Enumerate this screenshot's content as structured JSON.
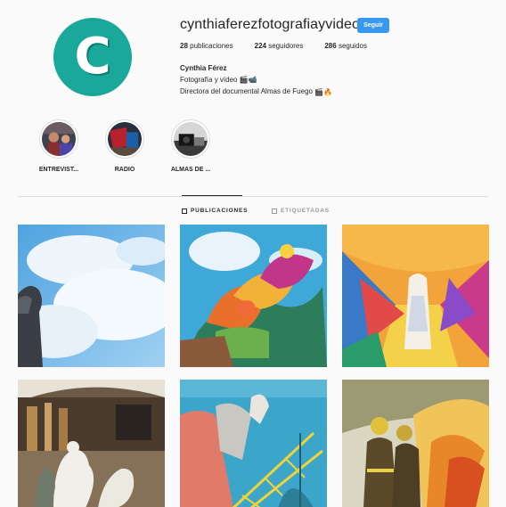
{
  "profile": {
    "username": "cynthiaferezfotografiayvideo",
    "follow_label": "Seguir",
    "avatar_letter": "C",
    "avatar_color": "#1aa89a",
    "stats": [
      {
        "count": "28",
        "label": "publicaciones"
      },
      {
        "count": "224",
        "label": "seguidores"
      },
      {
        "count": "286",
        "label": "seguidos"
      }
    ],
    "bio": {
      "name": "Cynthia Férez",
      "line1": "Fotografía y vídeo",
      "line1_emoji": "🎬📹",
      "line2": "Directora del documental Almas de Fuego",
      "line2_emoji": "🎬🔥"
    }
  },
  "highlights": [
    {
      "label": "ENTREVIST..."
    },
    {
      "label": "RADIO"
    },
    {
      "label": "ALMAS DE ..."
    }
  ],
  "tabs": [
    {
      "label": "PUBLICACIONES",
      "icon": "grid-icon",
      "active": true
    },
    {
      "label": "ETIQUETADAS",
      "icon": "tag-icon",
      "active": false
    }
  ],
  "colors": {
    "accent": "#3897f0",
    "text": "#262626",
    "muted": "#999999",
    "border": "#dbdbdb"
  }
}
